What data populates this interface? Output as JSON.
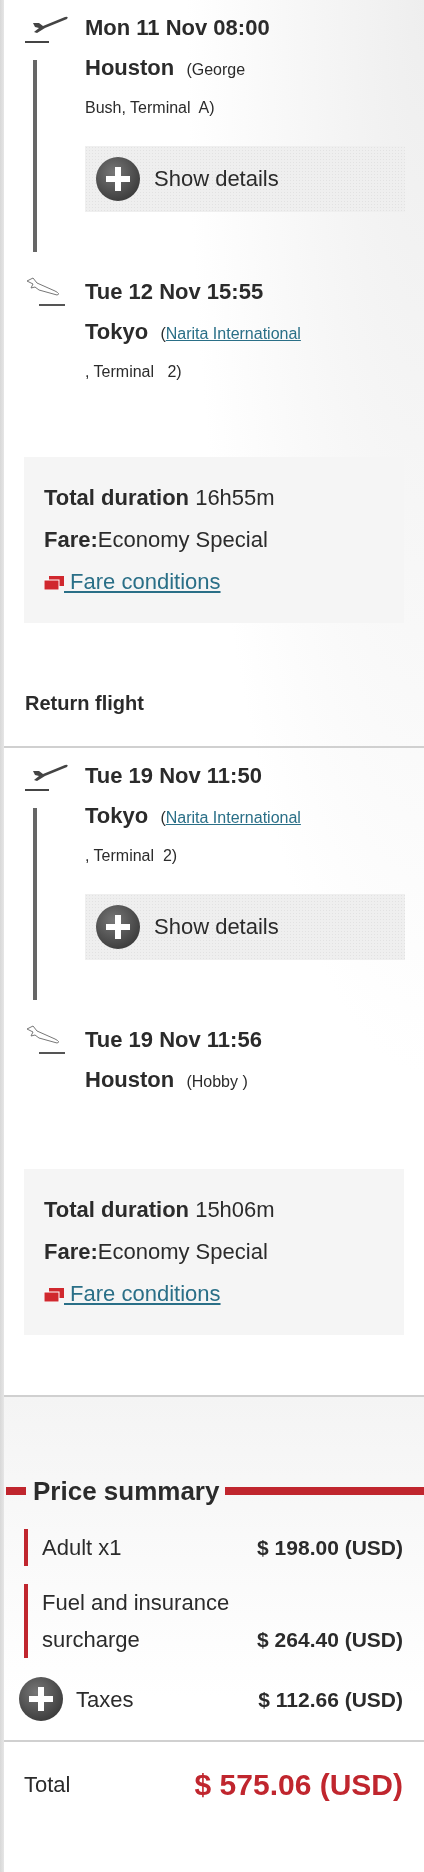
{
  "outbound": {
    "segments": [
      {
        "departure": {
          "datetime": "Mon 11 Nov 08:00",
          "city": "Houston",
          "airport": [
            {
              "kind": "text",
              "text": "(George"
            }
          ],
          "terminal": "Bush, Terminal  A)"
        },
        "details_button": "Show details",
        "arrival": {
          "datetime": "Tue 12 Nov 15:55",
          "city": "Tokyo",
          "airport": [
            {
              "kind": "text",
              "text": "("
            },
            {
              "kind": "link",
              "text": "Narita International"
            }
          ],
          "terminal": ", Terminal   2)"
        }
      }
    ],
    "summary": {
      "duration": "**Total duration** 16h55m",
      "fare": "**Fare:**Economy Special",
      "conditions_link": " Fare conditions"
    }
  },
  "return_flight": {
    "title": "Return flight",
    "segments": [
      {
        "departure": {
          "datetime": "Tue 19 Nov 11:50",
          "city": "Tokyo",
          "airport": [
            {
              "kind": "text",
              "text": "("
            },
            {
              "kind": "link",
              "text": "Narita International"
            }
          ],
          "terminal": ", Terminal  2)"
        },
        "details_button": "Show details",
        "arrival": {
          "datetime": "Tue 19 Nov 11:56",
          "city": "Houston",
          "airport": [
            {
              "kind": "text",
              "text": "(Hobby )"
            }
          ]
        }
      }
    ],
    "summary": {
      "duration": "**Total duration** 15h06m",
      "fare": "**Fare:**Economy Special",
      "conditions_link": " Fare conditions"
    }
  },
  "price_summary": {
    "title": "Price summary",
    "items": [
      {
        "kind": "item",
        "label": "Adult x1",
        "amount": "$ 198.00 (USD)"
      },
      {
        "kind": "item",
        "label": "Fuel and insurance surcharge",
        "amount": "$ 264.40 (USD)"
      },
      {
        "kind": "expandable",
        "label": "Taxes",
        "amount": "$ 112.66 (USD)"
      }
    ],
    "total": {
      "label": "Total",
      "amount": "$ 575.06 (USD)"
    }
  }
}
